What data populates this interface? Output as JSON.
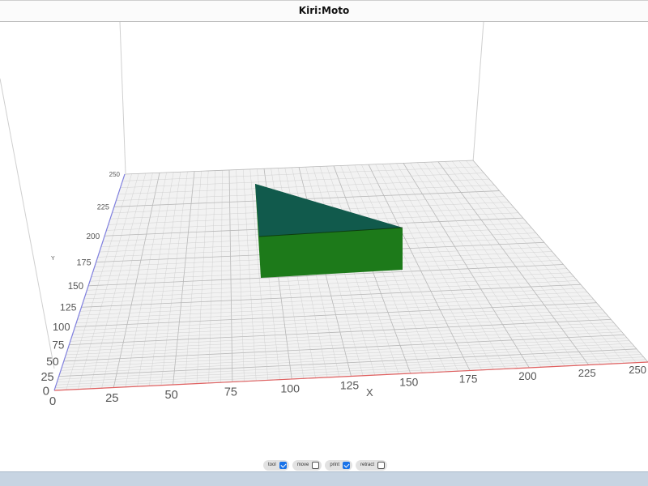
{
  "app": {
    "title": "Kiri:Moto"
  },
  "grid": {
    "x_axis_label": "X",
    "y_axis_label": "Y",
    "x_ticks": [
      "0",
      "25",
      "50",
      "75",
      "100",
      "125",
      "150",
      "175",
      "200",
      "225",
      "250"
    ],
    "y_ticks": [
      "0",
      "25",
      "50",
      "75",
      "100",
      "125",
      "150",
      "175",
      "200",
      "225",
      "250"
    ]
  },
  "colors": {
    "x_axis": "#e06060",
    "y_axis": "#8080e0",
    "grid_line": "#c9c9c9",
    "bed": "#f2f2f2",
    "part_side": "#1d7a1a",
    "part_top": "#115a4c"
  },
  "toggles": [
    {
      "label": "tool",
      "checked": true
    },
    {
      "label": "move",
      "checked": false
    },
    {
      "label": "print",
      "checked": true
    },
    {
      "label": "retract",
      "checked": false
    }
  ]
}
